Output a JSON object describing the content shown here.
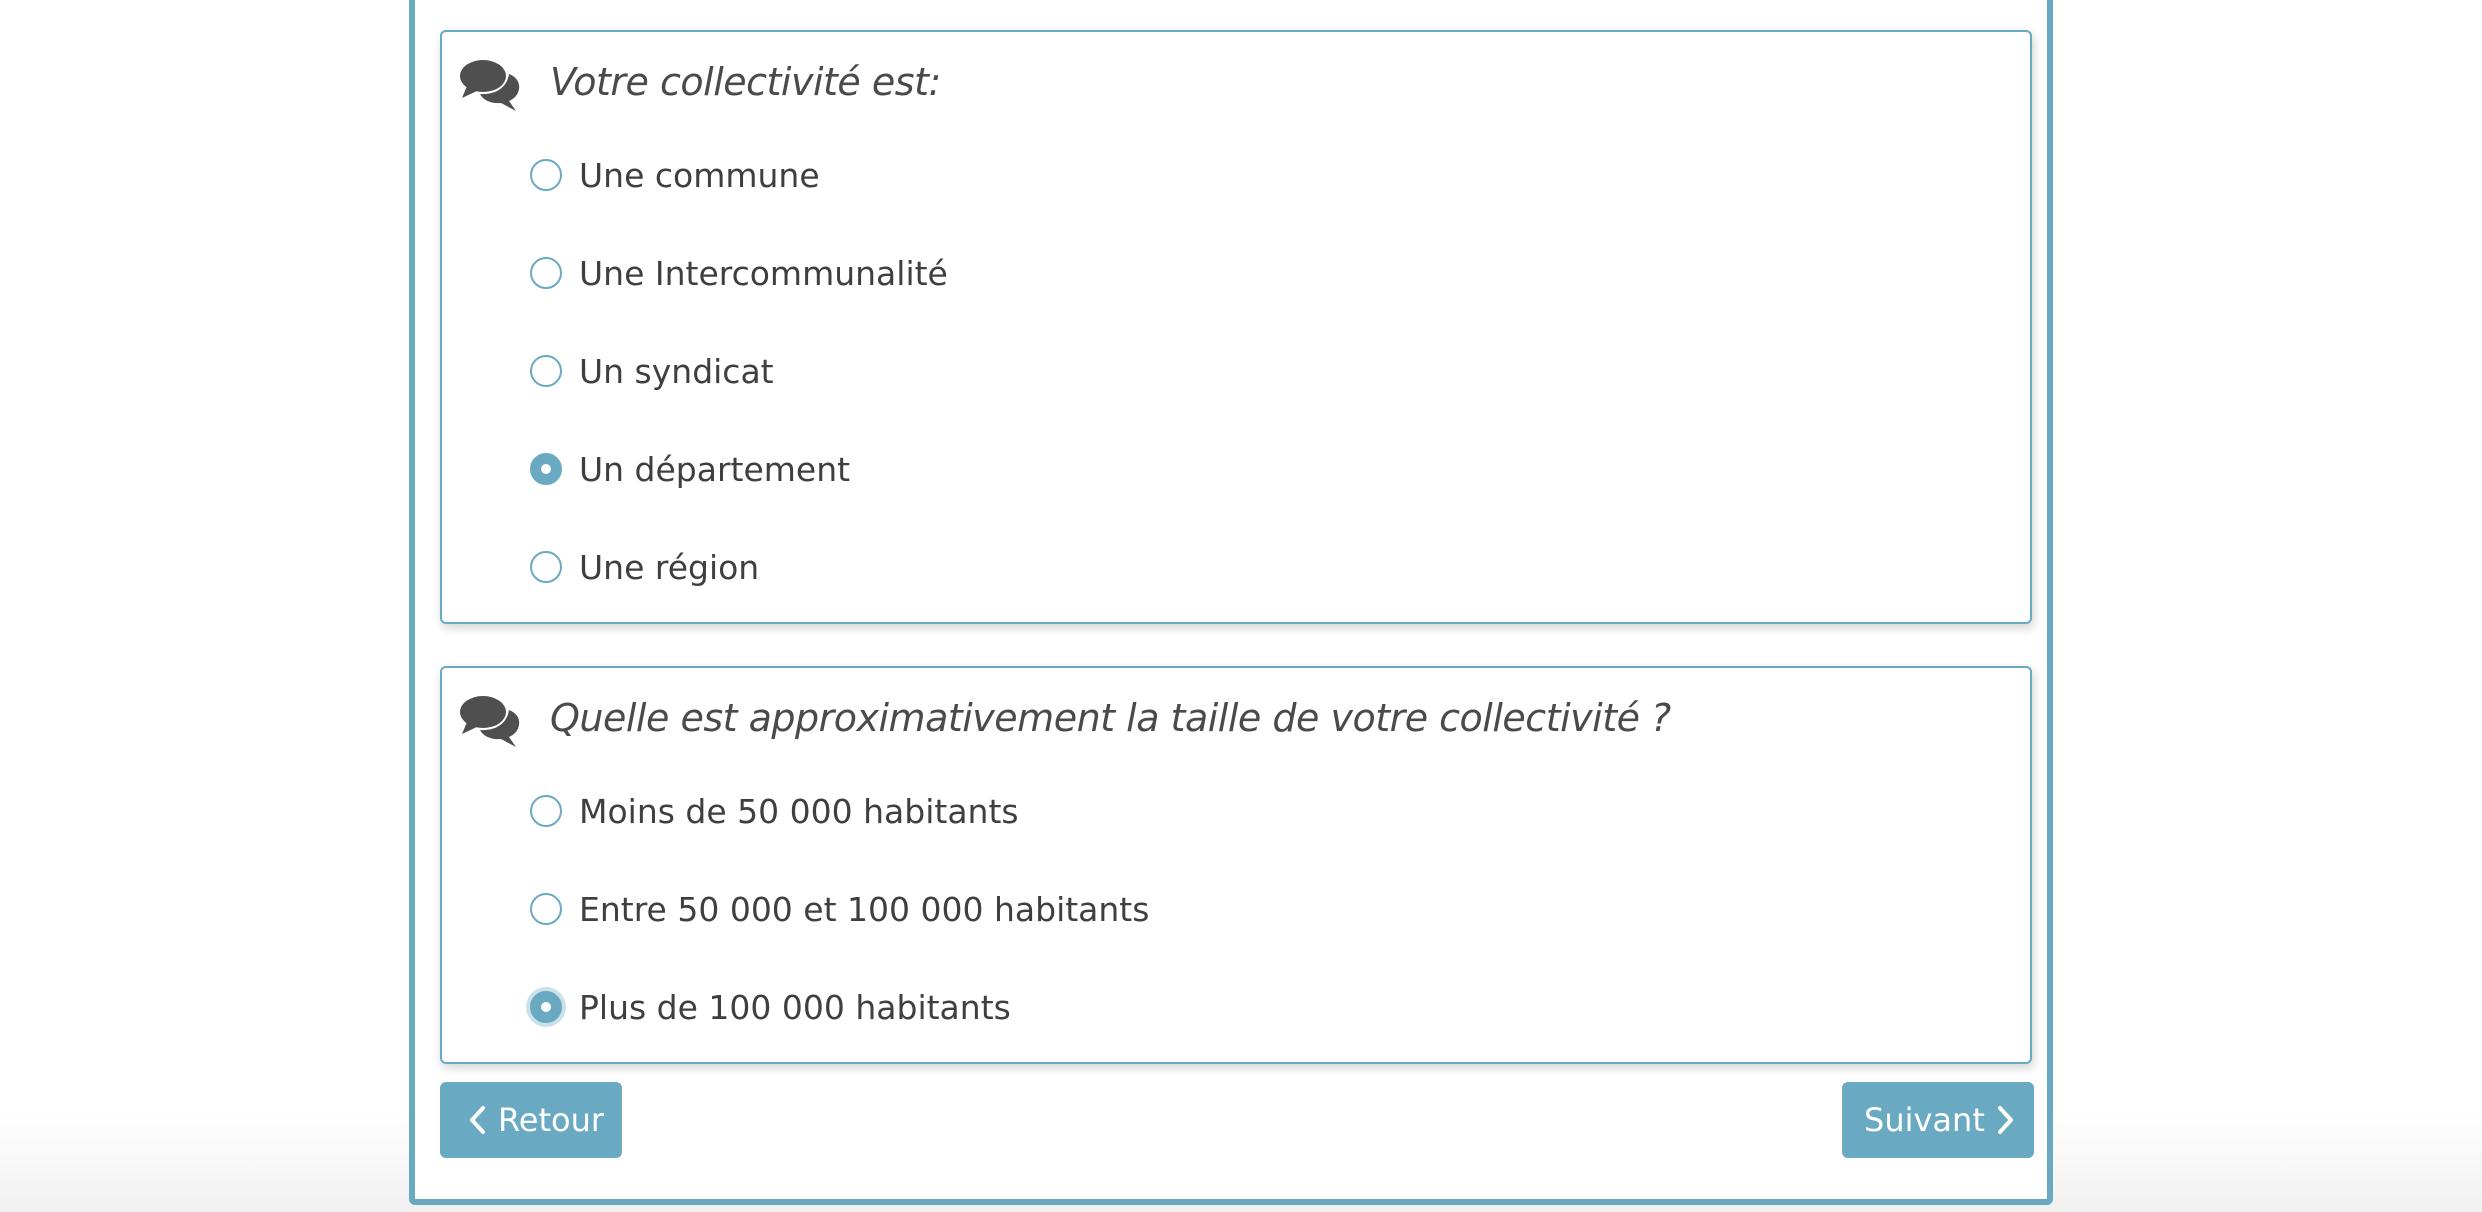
{
  "questions": [
    {
      "title": "Votre collectivité est:",
      "icon": "comments-icon",
      "options": [
        {
          "label": "Une commune",
          "checked": false
        },
        {
          "label": "Une Intercommunalité",
          "checked": false
        },
        {
          "label": "Un syndicat",
          "checked": false
        },
        {
          "label": "Un département",
          "checked": true
        },
        {
          "label": "Une région",
          "checked": false
        }
      ]
    },
    {
      "title": "Quelle est approximativement la taille de votre collectivité ?",
      "icon": "comments-icon",
      "options": [
        {
          "label": "Moins de 50 000 habitants",
          "checked": false
        },
        {
          "label": "Entre 50 000 et 100 000 habitants",
          "checked": false
        },
        {
          "label": "Plus de 100 000 habitants",
          "checked": true
        }
      ]
    }
  ],
  "nav": {
    "back_label": "Retour",
    "next_label": "Suivant"
  },
  "colors": {
    "accent": "#6aa9c2",
    "text": "#3f3f3f",
    "icon": "#4f4f4f"
  }
}
